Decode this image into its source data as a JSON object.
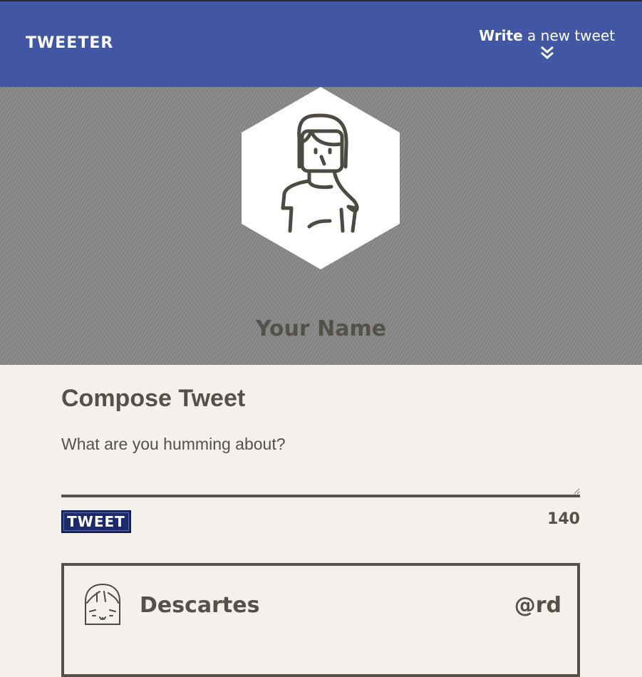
{
  "nav": {
    "brand": "TWEETER",
    "compose_strong": "Write",
    "compose_rest": " a new tweet",
    "compose_icon": "double-chevron-down-icon"
  },
  "profile": {
    "avatar_icon": "woman-avatar-icon",
    "name": "Your Name"
  },
  "composer": {
    "heading": "Compose Tweet",
    "placeholder": "What are you humming about?",
    "value": "",
    "submit_label": "TWEET",
    "counter": "140"
  },
  "tweets": [
    {
      "avatar_icon": "girl-avatar-icon",
      "name": "Descartes",
      "handle": "@rd"
    }
  ],
  "colors": {
    "nav_bg": "#4157a3",
    "page_bg": "#f4f1ec",
    "text": "#545149",
    "button_bg": "#1c2a6b",
    "header_bg": "#878787"
  }
}
